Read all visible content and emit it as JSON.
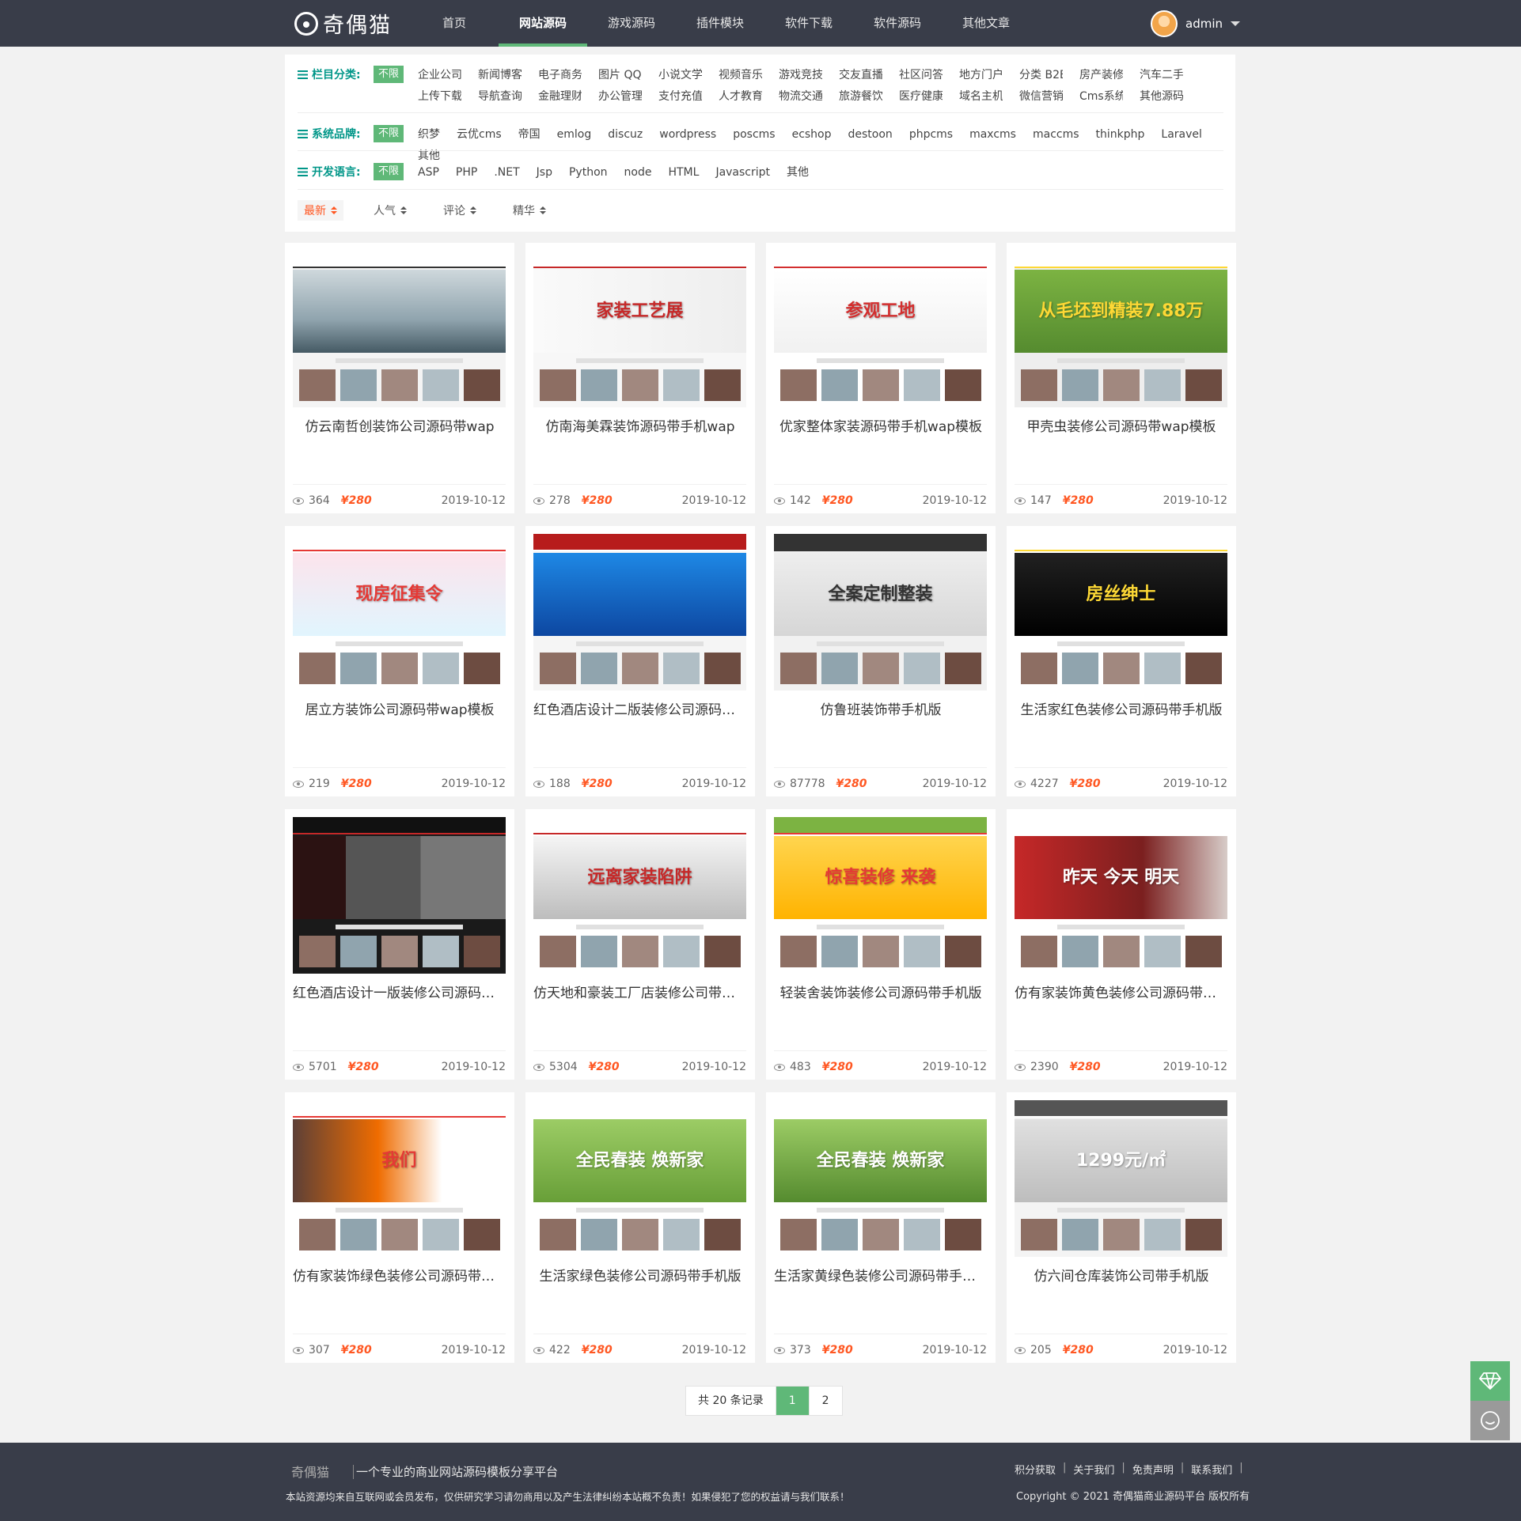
{
  "header": {
    "logo_text": "奇偶猫",
    "nav": [
      "首页",
      "网站源码",
      "游戏源码",
      "插件模块",
      "软件下载",
      "软件源码",
      "其他文章"
    ],
    "active_nav": "网站源码",
    "user_name": "admin"
  },
  "filters": {
    "all_label": "不限",
    "category": {
      "label": "栏目分类:",
      "items": [
        "企业公司",
        "新闻博客",
        "电子商务",
        "图片 QQ",
        "小说文学",
        "视频音乐",
        "游戏竞技",
        "交友直播",
        "社区问答",
        "地方门户",
        "分类 B2B",
        "房产装修",
        "汽车二手",
        "上传下载",
        "导航查询",
        "金融理财",
        "办公管理",
        "支付充值",
        "人才教育",
        "物流交通",
        "旅游餐饮",
        "医疗健康",
        "域名主机",
        "微信营销",
        "Cms系统",
        "其他源码"
      ]
    },
    "brand": {
      "label": "系统品牌:",
      "items": [
        "织梦",
        "云优cms",
        "帝国",
        "emlog",
        "discuz",
        "wordpress",
        "poscms",
        "ecshop",
        "destoon",
        "phpcms",
        "maxcms",
        "maccms",
        "thinkphp",
        "Laravel",
        "其他"
      ]
    },
    "language": {
      "label": "开发语言:",
      "items": [
        "ASP",
        "PHP",
        ".NET",
        "Jsp",
        "Python",
        "node",
        "HTML",
        "Javascript",
        "其他"
      ]
    },
    "sorts": [
      "最新",
      "人气",
      "评论",
      "精华"
    ],
    "active_sort": "最新"
  },
  "cards": [
    {
      "title": "仿云南哲创装饰公司源码带wap",
      "views": "364",
      "price": "¥280",
      "date": "2019-10-12"
    },
    {
      "title": "仿南海美霖装饰源码带手机wap",
      "views": "278",
      "price": "¥280",
      "date": "2019-10-12",
      "thumb_text": "家装工艺展"
    },
    {
      "title": "优家整体家装源码带手机wap模板",
      "views": "142",
      "price": "¥280",
      "date": "2019-10-12",
      "thumb_text": "参观工地"
    },
    {
      "title": "甲壳虫装修公司源码带wap模板",
      "views": "147",
      "price": "¥280",
      "date": "2019-10-12",
      "thumb_text": "从毛坯到精装7.88万"
    },
    {
      "title": "居立方装饰公司源码带wap模板",
      "views": "219",
      "price": "¥280",
      "date": "2019-10-12",
      "thumb_text": "现房征集令"
    },
    {
      "title": "红色酒店设计二版装修公司源码带手机版",
      "views": "188",
      "price": "¥280",
      "date": "2019-10-12"
    },
    {
      "title": "仿鲁班装饰带手机版",
      "views": "87778",
      "price": "¥280",
      "date": "2019-10-12",
      "thumb_text": "全案定制整装"
    },
    {
      "title": "生活家红色装修公司源码带手机版",
      "views": "4227",
      "price": "¥280",
      "date": "2019-10-12",
      "thumb_text": "房丝绅士"
    },
    {
      "title": "红色酒店设计一版装修公司源码带手机版",
      "views": "5701",
      "price": "¥280",
      "date": "2019-10-12"
    },
    {
      "title": "仿天地和豪装工厂店装修公司带手机版",
      "views": "5304",
      "price": "¥280",
      "date": "2019-10-12",
      "thumb_text": "远离家装陷阱"
    },
    {
      "title": "轻装舍装饰装修公司源码带手机版",
      "views": "483",
      "price": "¥280",
      "date": "2019-10-12",
      "thumb_text": "惊喜装修 来袭"
    },
    {
      "title": "仿有家装饰黄色装修公司源码带手机版",
      "views": "2390",
      "price": "¥280",
      "date": "2019-10-12",
      "thumb_text": "昨天 今天 明天"
    },
    {
      "title": "仿有家装饰绿色装修公司源码带手机版",
      "views": "307",
      "price": "¥280",
      "date": "2019-10-12",
      "thumb_text": "我们"
    },
    {
      "title": "生活家绿色装修公司源码带手机版",
      "views": "422",
      "price": "¥280",
      "date": "2019-10-12",
      "thumb_text": "全民春装 焕新家"
    },
    {
      "title": "生活家黄绿色装修公司源码带手机版",
      "views": "373",
      "price": "¥280",
      "date": "2019-10-12",
      "thumb_text": "全民春装 焕新家"
    },
    {
      "title": "仿六间仓库装饰公司带手机版",
      "views": "205",
      "price": "¥280",
      "date": "2019-10-12",
      "thumb_text": "1299元/㎡"
    }
  ],
  "pagination": {
    "total": "共 20 条记录",
    "pages": [
      "1",
      "2"
    ],
    "current": "1"
  },
  "footer": {
    "logo_text": "奇偶猫",
    "slogan": "一个专业的商业网站源码模板分享平台",
    "note": "本站资源均来自互联网或会员发布，仅供研究学习请勿商用以及产生法律纠纷本站概不负责！如果侵犯了您的权益请与我们联系！",
    "links": [
      "积分获取",
      "关于我们",
      "免责声明",
      "联系我们"
    ],
    "copyright": "Copyright © 2021 奇偶猫商业源码平台 版权所有"
  },
  "colors": {
    "header": "#393d49",
    "accent": "#5fb878",
    "label": "#009688",
    "price": "#ff5722"
  }
}
